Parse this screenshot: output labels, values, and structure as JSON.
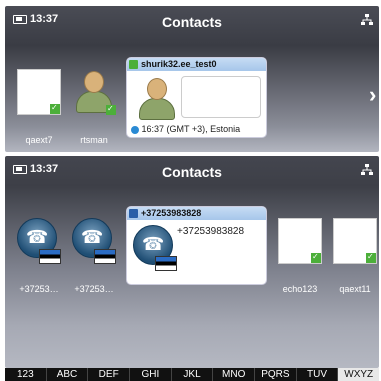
{
  "screen1": {
    "time": "13:37",
    "title": "Contacts",
    "contacts": [
      {
        "label": "qaext7"
      },
      {
        "label": "rtsman"
      }
    ],
    "card": {
      "name": "shurik32.ee_test0",
      "footer": "16:37 (GMT +3), Estonia"
    }
  },
  "screen2": {
    "time": "13:37",
    "title": "Contacts",
    "contacts": [
      {
        "label": "+37253…"
      },
      {
        "label": "+37253…"
      },
      {
        "label": "echo123"
      },
      {
        "label": "qaext11"
      }
    ],
    "card": {
      "name": "+37253983828",
      "number": "+37253983828"
    }
  },
  "alphabet": [
    "123",
    "ABC",
    "DEF",
    "GHI",
    "JKL",
    "MNO",
    "PQRS",
    "TUV",
    "WXYZ"
  ],
  "alphabet_active": "WXYZ",
  "colors": {
    "check": "#4caf3a",
    "card_header": "#b7d1ef"
  }
}
